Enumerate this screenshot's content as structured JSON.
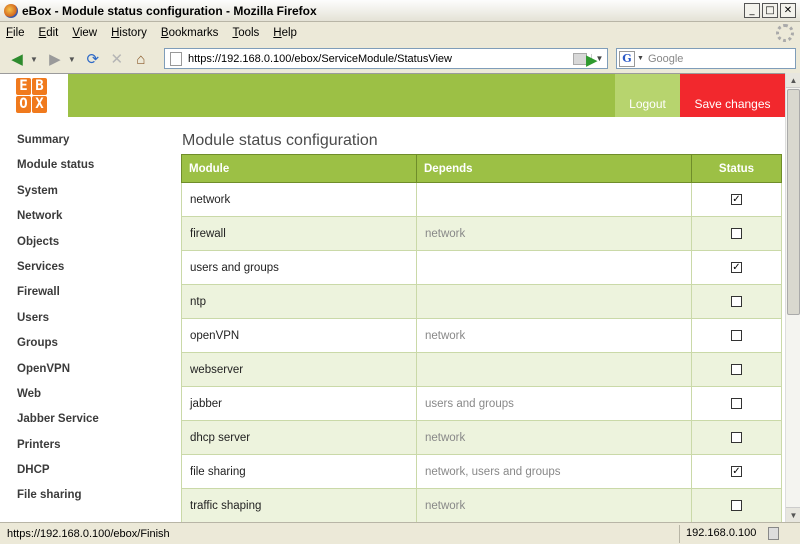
{
  "window": {
    "title": "eBox - Module status configuration - Mozilla Firefox",
    "controls": [
      "_",
      "□",
      "✕"
    ]
  },
  "menubar": {
    "items": [
      {
        "key": "F",
        "rest": "ile"
      },
      {
        "key": "E",
        "rest": "dit"
      },
      {
        "key": "V",
        "rest": "iew"
      },
      {
        "key": "H",
        "rest": "istory"
      },
      {
        "key": "B",
        "rest": "ookmarks"
      },
      {
        "key": "T",
        "rest": "ools"
      },
      {
        "key": "H",
        "rest": "elp"
      }
    ]
  },
  "navbar": {
    "url": "https://192.168.0.100/ebox/ServiceModule/StatusView",
    "search_placeholder": "Google",
    "search_engine_icon": "G"
  },
  "header": {
    "logo_letters": [
      "E",
      "B",
      "O",
      "X"
    ],
    "logout": "Logout",
    "save_changes": "Save changes",
    "colors": {
      "green": "#9cc045",
      "red": "#f2282d",
      "orange": "#f07a1d"
    }
  },
  "sidebar": {
    "items": [
      "Summary",
      "Module status",
      "System",
      "Network",
      "Objects",
      "Services",
      "Firewall",
      "Users",
      "Groups",
      "OpenVPN",
      "Web",
      "Jabber Service",
      "Printers",
      "DHCP",
      "File sharing"
    ]
  },
  "main": {
    "title": "Module status configuration",
    "columns": {
      "module": "Module",
      "depends": "Depends",
      "status": "Status"
    },
    "rows": [
      {
        "module": "network",
        "depends": "",
        "checked": true
      },
      {
        "module": "firewall",
        "depends": "network",
        "checked": false
      },
      {
        "module": "users and groups",
        "depends": "",
        "checked": true
      },
      {
        "module": "ntp",
        "depends": "",
        "checked": false
      },
      {
        "module": "openVPN",
        "depends": "network",
        "checked": false
      },
      {
        "module": "webserver",
        "depends": "",
        "checked": false
      },
      {
        "module": "jabber",
        "depends": "users and groups",
        "checked": false
      },
      {
        "module": "dhcp server",
        "depends": "network",
        "checked": false
      },
      {
        "module": "file sharing",
        "depends": "network, users and groups",
        "checked": true
      },
      {
        "module": "traffic shaping",
        "depends": "network",
        "checked": false
      }
    ]
  },
  "statusbar": {
    "text": "https://192.168.0.100/ebox/Finish",
    "host": "192.168.0.100"
  }
}
